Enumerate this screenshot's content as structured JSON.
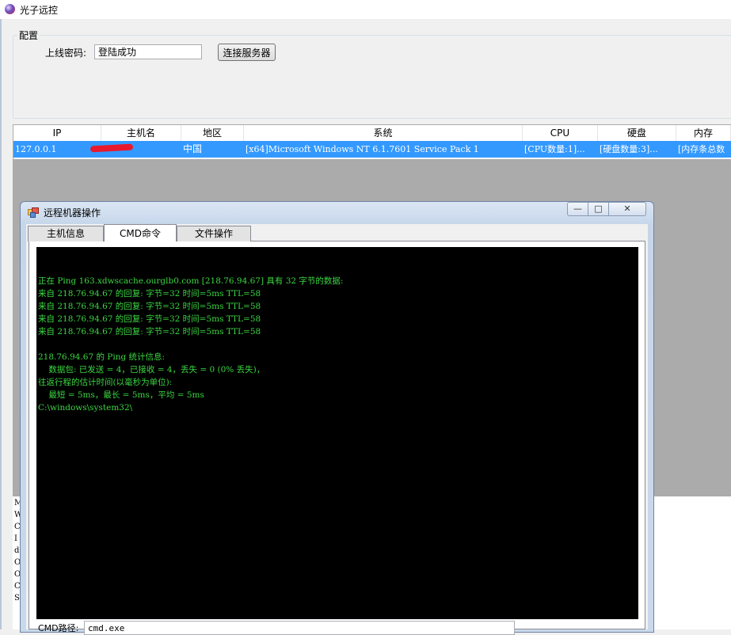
{
  "window": {
    "title": "光子远控"
  },
  "config": {
    "group_label": "配置",
    "password_label": "上线密码:",
    "password_value": "登陆成功",
    "connect_button": "连接服务器"
  },
  "list": {
    "columns": [
      "IP",
      "主机名",
      "地区",
      "系统",
      "CPU",
      "硬盘",
      "内存"
    ],
    "rows": [
      {
        "ip": "127.0.0.1",
        "hostname": "",
        "region": "中国",
        "os": "[x64]Microsoft Windows NT 6.1.7601 Service Pack 1",
        "cpu": "[CPU数量:1]...",
        "disk": "[硬盘数量:3]...",
        "memory": "[内存条总数"
      }
    ]
  },
  "side_text": "MWCIdOOCS",
  "dialog": {
    "title": "远程机器操作",
    "minimize": "—",
    "maximize": "□",
    "close": "✕",
    "tabs": [
      "主机信息",
      "CMD命令",
      "文件操作"
    ],
    "active_tab": 1,
    "console_lines": [
      "正在 Ping 163.xdwscache.ourglb0.com [218.76.94.67] 具有 32 字节的数据:",
      "来自 218.76.94.67 的回复: 字节=32 时间=5ms TTL=58",
      "来自 218.76.94.67 的回复: 字节=32 时间=5ms TTL=58",
      "来自 218.76.94.67 的回复: 字节=32 时间=5ms TTL=58",
      "来自 218.76.94.67 的回复: 字节=32 时间=5ms TTL=58",
      "",
      "218.76.94.67 的 Ping 统计信息:",
      "    数据包: 已发送 = 4，已接收 = 4，丢失 = 0 (0% 丢失)，",
      "往返行程的估计时间(以毫秒为单位):",
      "    最短 = 5ms，最长 = 5ms，平均 = 5ms",
      "C:\\windows\\system32\\"
    ],
    "cmd_path_label": "CMD路径:",
    "cmd_path_value": "cmd.exe"
  },
  "colors": {
    "selection": "#3399ff",
    "console_bg": "#000000",
    "console_fg": "#3bd641"
  }
}
